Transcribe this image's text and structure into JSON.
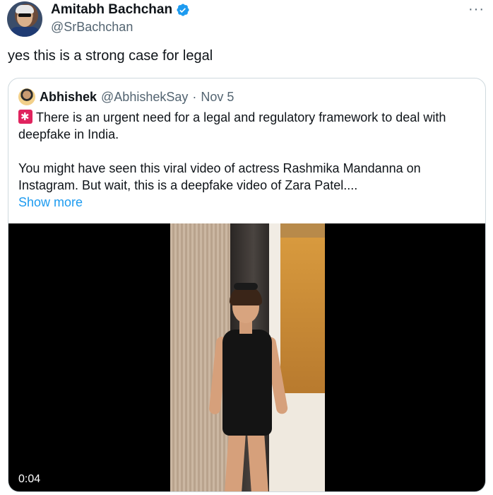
{
  "author": {
    "display_name": "Amitabh Bachchan",
    "handle": "@SrBachchan",
    "verified_icon": "verified-badge-icon",
    "avatar_icon": "profile-photo"
  },
  "more_label": "···",
  "tweet_text": "yes this is a strong case for legal",
  "quote": {
    "display_name": "Abhishek",
    "handle": "@AbhishekSay",
    "separator": "·",
    "date": "Nov 5",
    "line1": "There is an urgent need for a legal and regulatory framework to deal with deepfake in India.",
    "line2": "You might have seen this viral video of actress Rashmika Mandanna on Instagram. But wait, this is a deepfake video of Zara Patel....",
    "show_more": "Show more",
    "emoji_icon": "siren-icon"
  },
  "video": {
    "timestamp": "0:04"
  },
  "colors": {
    "link": "#1d9bf0",
    "secondary_text": "#536471",
    "border": "#cfd9de"
  }
}
